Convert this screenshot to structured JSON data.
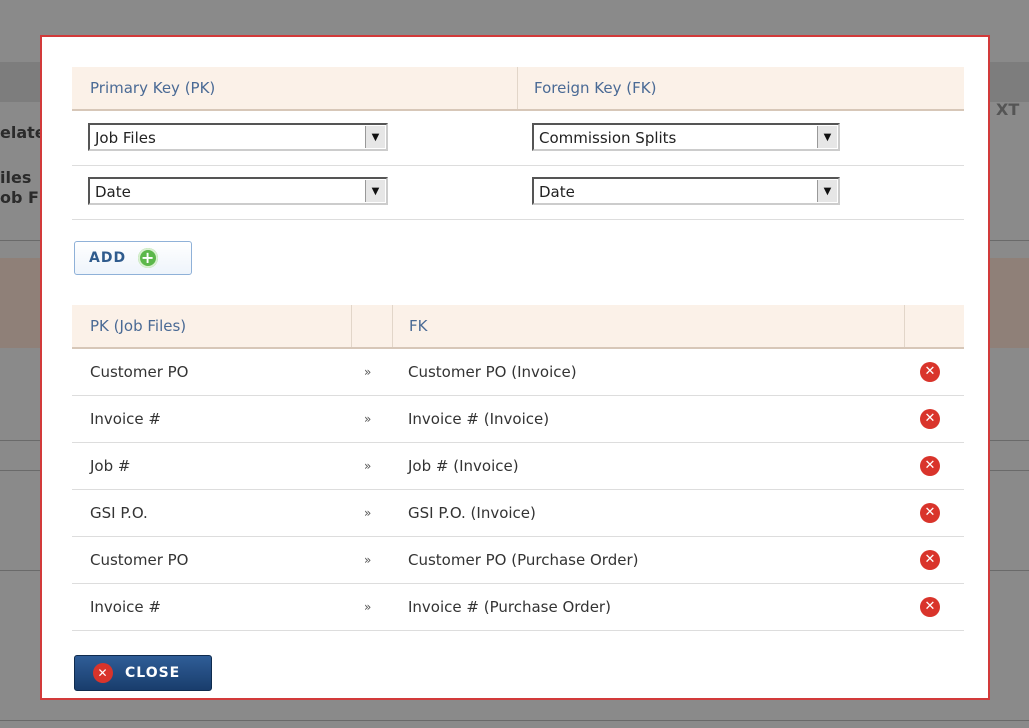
{
  "background": {
    "fragment_1": "elate",
    "fragment_2": "iles",
    "fragment_3": "ob F",
    "fragment_4": "XT"
  },
  "keys": {
    "pk_header": "Primary Key (PK)",
    "fk_header": "Foreign Key (FK)",
    "rows": [
      {
        "pk": "Job Files",
        "fk": "Commission Splits"
      },
      {
        "pk": "Date",
        "fk": "Date"
      }
    ]
  },
  "add_button": {
    "label": "ADD"
  },
  "mapping": {
    "pk_header": "PK (Job Files)",
    "fk_header": "FK",
    "separator": "»",
    "rows": [
      {
        "pk": "Customer PO",
        "fk": "Customer PO (Invoice)"
      },
      {
        "pk": "Invoice #",
        "fk": "Invoice # (Invoice)"
      },
      {
        "pk": "Job #",
        "fk": "Job # (Invoice)"
      },
      {
        "pk": "GSI P.O.",
        "fk": "GSI P.O. (Invoice)"
      },
      {
        "pk": "Customer PO",
        "fk": "Customer PO (Purchase Order)"
      },
      {
        "pk": "Invoice #",
        "fk": "Invoice # (Purchase Order)"
      }
    ]
  },
  "close_button": {
    "label": "CLOSE"
  },
  "colors": {
    "modal_border": "#d23a3a",
    "header_bg": "#fbf1e8",
    "header_text": "#4a6a95",
    "close_bg": "#193d6c",
    "delete_icon": "#d9342b",
    "add_icon": "#5cb84a"
  }
}
